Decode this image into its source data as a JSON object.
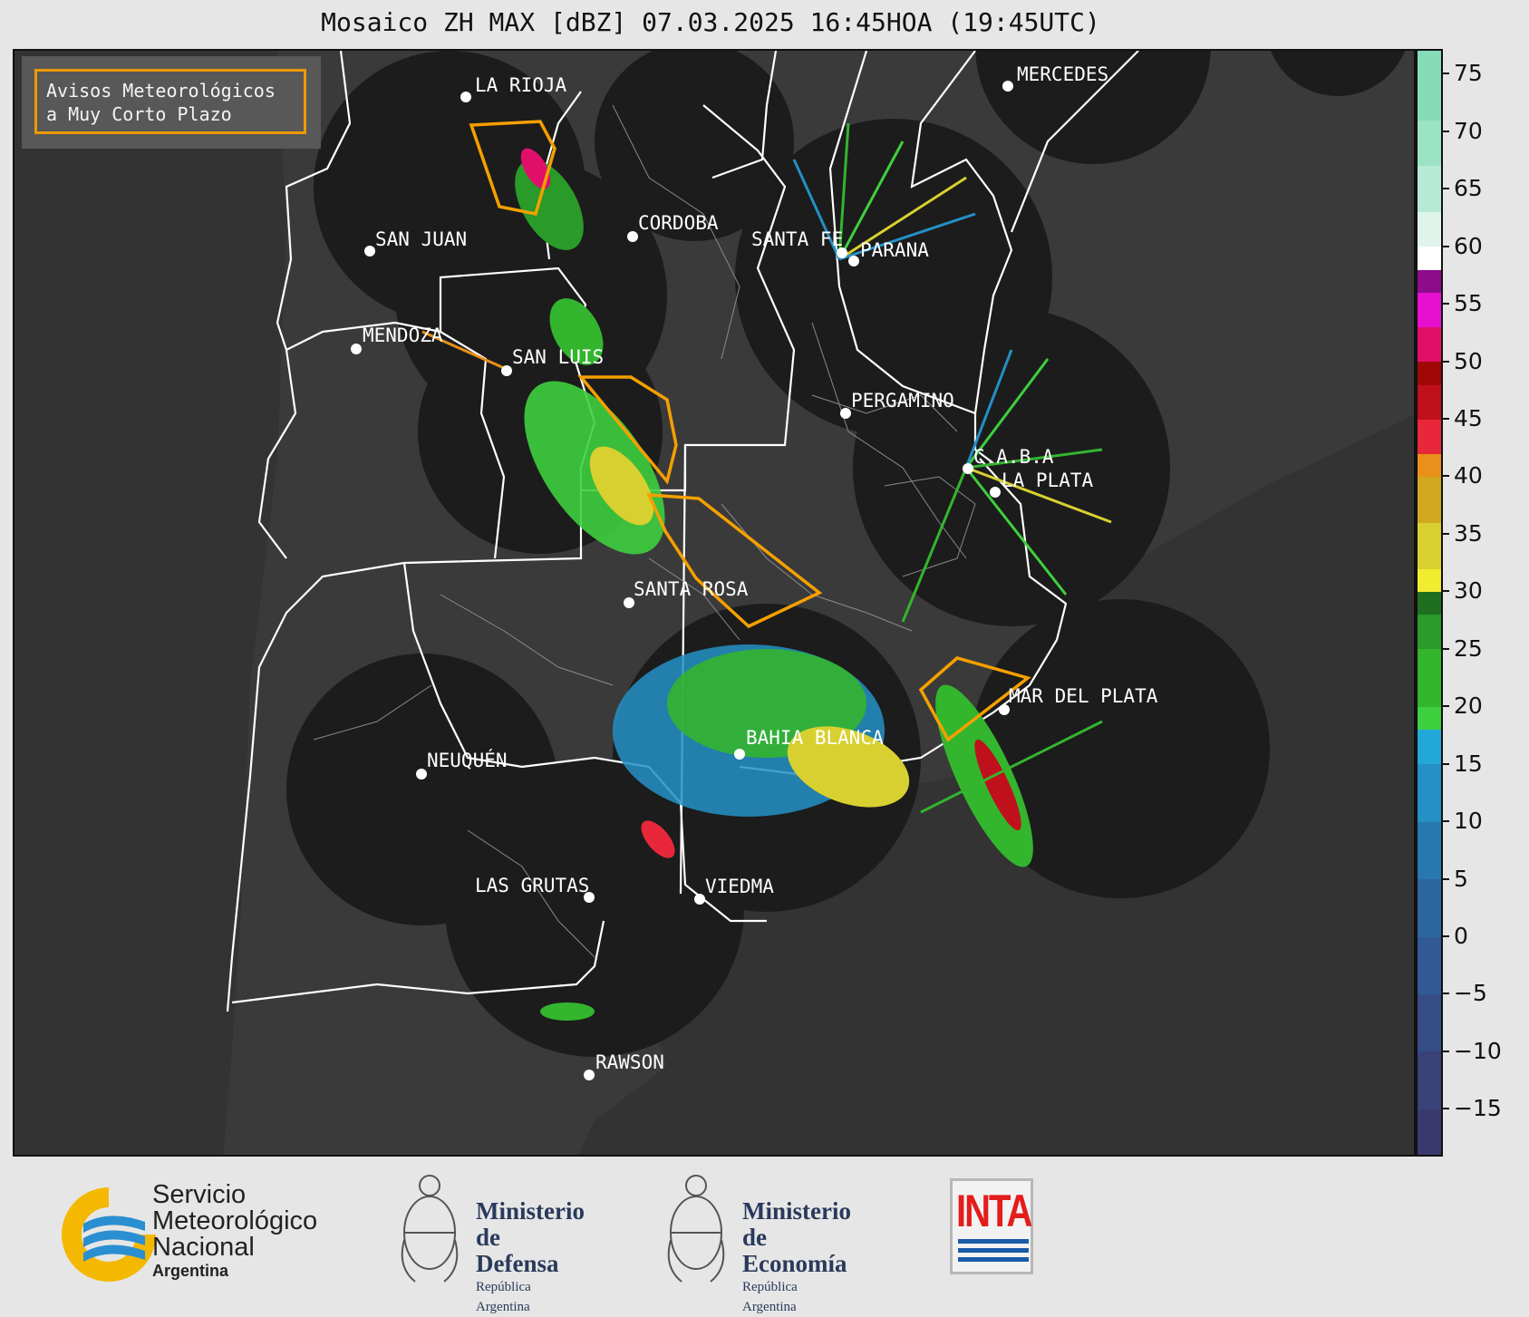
{
  "title": "Mosaico ZH MAX [dBZ] 07.03.2025 16:45HOA (19:45UTC)",
  "legend": {
    "line1": "Avisos Meteorológicos",
    "line2": "a Muy Corto Plazo",
    "outline_color": "#f5a000"
  },
  "colors": {
    "map_background": "#333333",
    "radar_disk": "#1c1c1c",
    "borders": "#ffffff",
    "alert_polygon": "#f5a000"
  },
  "cities": [
    {
      "name": "LA RIOJA"
    },
    {
      "name": "CORDOBA"
    },
    {
      "name": "SAN JUAN"
    },
    {
      "name": "SANTA FE"
    },
    {
      "name": "PARANA"
    },
    {
      "name": "MERCEDES"
    },
    {
      "name": "MENDOZA"
    },
    {
      "name": "SAN LUIS"
    },
    {
      "name": "PERGAMINO"
    },
    {
      "name": "C.A.B.A"
    },
    {
      "name": "LA PLATA"
    },
    {
      "name": "SANTA ROSA"
    },
    {
      "name": "MAR DEL PLATA"
    },
    {
      "name": "BAHIA BLANCA"
    },
    {
      "name": "NEUQUÉN"
    },
    {
      "name": "LAS GRUTAS"
    },
    {
      "name": "VIEDMA"
    },
    {
      "name": "RAWSON"
    }
  ],
  "colorbar": {
    "min": -19,
    "max": 77,
    "ticks": [
      "75",
      "70",
      "65",
      "60",
      "55",
      "50",
      "45",
      "40",
      "35",
      "30",
      "25",
      "20",
      "15",
      "10",
      "5",
      "0",
      "−5",
      "−10",
      "−15"
    ],
    "tick_values": [
      75,
      70,
      65,
      60,
      55,
      50,
      45,
      40,
      35,
      30,
      25,
      20,
      15,
      10,
      5,
      0,
      -5,
      -10,
      -15
    ],
    "bands": [
      {
        "from": -19,
        "to": -15,
        "color": "#3a3a6e"
      },
      {
        "from": -15,
        "to": -10,
        "color": "#394279"
      },
      {
        "from": -10,
        "to": -5,
        "color": "#364d86"
      },
      {
        "from": -5,
        "to": 0,
        "color": "#325a93"
      },
      {
        "from": 0,
        "to": 5,
        "color": "#2d67a0"
      },
      {
        "from": 5,
        "to": 10,
        "color": "#2878b0"
      },
      {
        "from": 10,
        "to": 15,
        "color": "#2490c5"
      },
      {
        "from": 15,
        "to": 18,
        "color": "#22a8d8"
      },
      {
        "from": 18,
        "to": 20,
        "color": "#3ecf3e"
      },
      {
        "from": 20,
        "to": 25,
        "color": "#33b52e"
      },
      {
        "from": 25,
        "to": 28,
        "color": "#2a9a28"
      },
      {
        "from": 28,
        "to": 30,
        "color": "#1f6f1f"
      },
      {
        "from": 30,
        "to": 32,
        "color": "#f0ec30"
      },
      {
        "from": 32,
        "to": 36,
        "color": "#d8d030"
      },
      {
        "from": 36,
        "to": 40,
        "color": "#d0a820"
      },
      {
        "from": 40,
        "to": 42,
        "color": "#e8901a"
      },
      {
        "from": 42,
        "to": 45,
        "color": "#e8283a"
      },
      {
        "from": 45,
        "to": 48,
        "color": "#c0101c"
      },
      {
        "from": 48,
        "to": 50,
        "color": "#a00808"
      },
      {
        "from": 50,
        "to": 53,
        "color": "#e0106a"
      },
      {
        "from": 53,
        "to": 56,
        "color": "#e810d0"
      },
      {
        "from": 56,
        "to": 58,
        "color": "#8c0c8c"
      },
      {
        "from": 58,
        "to": 60,
        "color": "#ffffff"
      },
      {
        "from": 60,
        "to": 63,
        "color": "#dff5ec"
      },
      {
        "from": 63,
        "to": 67,
        "color": "#b5ebd5"
      },
      {
        "from": 67,
        "to": 71,
        "color": "#9ce3c6"
      },
      {
        "from": 71,
        "to": 77,
        "color": "#86dcb8"
      }
    ]
  },
  "logos": {
    "smn": {
      "line1": "Servicio",
      "line2": "Meteorológico",
      "line3": "Nacional",
      "line4": "Argentina"
    },
    "defensa": {
      "line1": "Ministerio",
      "line2": "de Defensa",
      "line3": "República Argentina"
    },
    "economia": {
      "line1": "Ministerio",
      "line2": "de Economía",
      "line3": "República Argentina"
    },
    "inta": {
      "word": "INTA"
    }
  }
}
